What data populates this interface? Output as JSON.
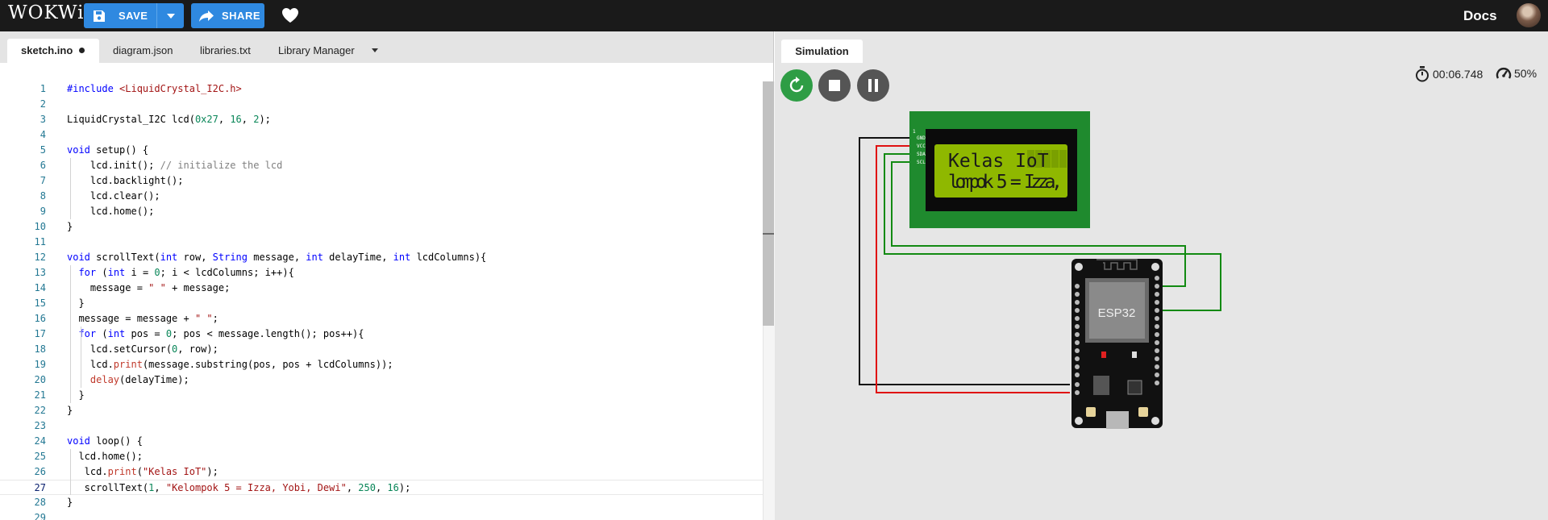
{
  "topbar": {
    "logo": "WOKWi",
    "save_label": "SAVE",
    "share_label": "SHARE",
    "docs_label": "Docs"
  },
  "editor": {
    "tabs": [
      {
        "label": "sketch.ino",
        "active": true,
        "modified": true
      },
      {
        "label": "diagram.json"
      },
      {
        "label": "libraries.txt"
      },
      {
        "label": "Library Manager"
      }
    ],
    "current_line": 27,
    "lines": [
      "#include <LiquidCrystal_I2C.h>",
      "",
      "LiquidCrystal_I2C lcd(0x27, 16, 2);",
      "",
      "void setup() {",
      "    lcd.init(); // initialize the lcd",
      "    lcd.backlight();",
      "    lcd.clear();",
      "    lcd.home();",
      "}",
      "",
      "void scrollText(int row, String message, int delayTime, int lcdColumns){",
      "  for (int i = 0; i < lcdColumns; i++){",
      "    message = \" \" + message;",
      "  }",
      "  message = message + \" \";",
      "  for (int pos = 0; pos < message.length(); pos++){",
      "    lcd.setCursor(0, row);",
      "    lcd.print(message.substring(pos, pos + lcdColumns));",
      "    delay(delayTime);",
      "  }",
      "}",
      "",
      "void loop() {",
      "  lcd.home();",
      "   lcd.print(\"Kelas IoT\");",
      "   scrollText(1, \"Kelompok 5 = Izza, Yobi, Dewi\", 250, 16);",
      "}",
      ""
    ]
  },
  "simulation": {
    "tab_label": "Simulation",
    "timer": "00:06.748",
    "speed": "50%",
    "lcd": {
      "line1": "Kelas IoT",
      "line2": "lompok 5 = Izza,",
      "pins": [
        "GND",
        "VCC",
        "SDA",
        "SCL"
      ]
    },
    "board_label": "ESP32"
  },
  "colors": {
    "topbar": "#1a1a1a",
    "button": "#2f89e0",
    "restart": "#2e9d45",
    "control": "#555555",
    "lcd_pcb": "#1f8a2e",
    "lcd_screen": "#8fb800",
    "wire_gnd": "#111111",
    "wire_vcc": "#e01010",
    "wire_data": "#128a12"
  },
  "icons": [
    "save-icon",
    "chevron-down-icon",
    "share-icon",
    "heart-icon",
    "restart-icon",
    "stop-icon",
    "pause-icon",
    "stopwatch-icon",
    "speedometer-icon"
  ]
}
